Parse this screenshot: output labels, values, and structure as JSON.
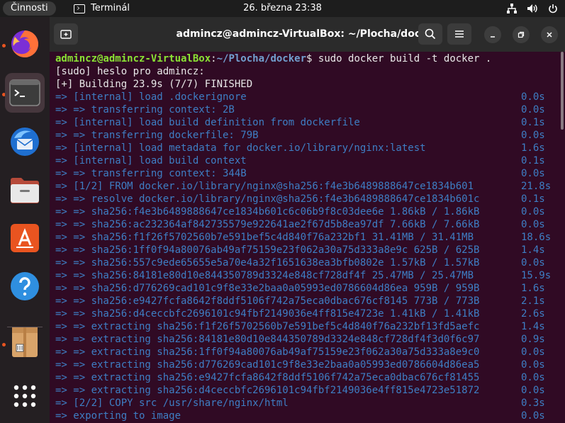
{
  "topbar": {
    "activities": "Činnosti",
    "app_name": "Terminál",
    "clock": "26. března  23:38",
    "tray_icons": [
      "network-icon",
      "volume-icon",
      "power-icon"
    ]
  },
  "dock": {
    "items": [
      {
        "name": "firefox",
        "running": true
      },
      {
        "name": "terminal",
        "running": true,
        "active": true
      },
      {
        "name": "thunderbird",
        "running": false
      },
      {
        "name": "files",
        "running": false
      },
      {
        "name": "app-center",
        "running": false
      },
      {
        "name": "help",
        "running": false
      },
      {
        "name": "archive-manager",
        "running": true
      },
      {
        "name": "show-apps",
        "running": false
      }
    ]
  },
  "window": {
    "title": "admincz@admincz-VirtualBox: ~/Plocha/docker"
  },
  "terminal": {
    "prompt_user": "admincz@admincz-VirtualBox",
    "prompt_sep": ":",
    "prompt_path": "~/Plocha/docker",
    "prompt_end": "$ ",
    "command": "sudo docker build -t docker .",
    "lines": [
      {
        "text": "[sudo] heslo pro admincz:",
        "time": "",
        "style": "plain"
      },
      {
        "text": "[+] Building 23.9s (7/7) FINISHED",
        "time": "",
        "style": "plain"
      },
      {
        "text": "=> [internal] load .dockerignore",
        "time": "0.0s",
        "style": "dim"
      },
      {
        "text": "=> => transferring context: 2B",
        "time": "0.0s",
        "style": "dim"
      },
      {
        "text": "=> [internal] load build definition from dockerfile",
        "time": "0.1s",
        "style": "dim"
      },
      {
        "text": "=> => transferring dockerfile: 79B",
        "time": "0.0s",
        "style": "dim"
      },
      {
        "text": "=> [internal] load metadata for docker.io/library/nginx:latest",
        "time": "1.6s",
        "style": "dim"
      },
      {
        "text": "=> [internal] load build context",
        "time": "0.1s",
        "style": "dim"
      },
      {
        "text": "=> => transferring context: 344B",
        "time": "0.0s",
        "style": "dim"
      },
      {
        "text": "=> [1/2] FROM docker.io/library/nginx@sha256:f4e3b6489888647ce1834b601",
        "time": "21.8s",
        "style": "dim"
      },
      {
        "text": "=> => resolve docker.io/library/nginx@sha256:f4e3b6489888647ce1834b601c",
        "time": "0.1s",
        "style": "dim"
      },
      {
        "text": "=> => sha256:f4e3b6489888647ce1834b601c6c06b9f8c03dee6e 1.86kB / 1.86kB",
        "time": "0.0s",
        "style": "dim"
      },
      {
        "text": "=> => sha256:ac232364af842735579e922641ae2f67d5b8ea97df 7.66kB / 7.66kB",
        "time": "0.0s",
        "style": "dim"
      },
      {
        "text": "=> => sha256:f1f26f5702560b7e591bef5c4d840f76a232bf1 31.41MB / 31.41MB",
        "time": "18.6s",
        "style": "dim"
      },
      {
        "text": "=> => sha256:1ff0f94a80076ab49af75159e23f062a30a75d333a8e9c 625B / 625B",
        "time": "1.4s",
        "style": "dim"
      },
      {
        "text": "=> => sha256:557c9ede65655e5a70e4a32f1651638ea3bfb0802e 1.57kB / 1.57kB",
        "time": "0.0s",
        "style": "dim"
      },
      {
        "text": "=> => sha256:84181e80d10e844350789d3324e848cf728df4f 25.47MB / 25.47MB",
        "time": "15.9s",
        "style": "dim"
      },
      {
        "text": "=> => sha256:d776269cad101c9f8e33e2baa0a05993ed0786604d86ea 959B / 959B",
        "time": "1.6s",
        "style": "dim"
      },
      {
        "text": "=> => sha256:e9427fcfa8642f8ddf5106f742a75eca0dbac676cf8145 773B / 773B",
        "time": "2.1s",
        "style": "dim"
      },
      {
        "text": "=> => sha256:d4ceccbfc2696101c94fbf2149036e4ff815e4723e 1.41kB / 1.41kB",
        "time": "2.6s",
        "style": "dim"
      },
      {
        "text": "=> => extracting sha256:f1f26f5702560b7e591bef5c4d840f76a232bf13fd5aefc",
        "time": "1.4s",
        "style": "dim"
      },
      {
        "text": "=> => extracting sha256:84181e80d10e844350789d3324e848cf728df4f3d0f6c97",
        "time": "0.9s",
        "style": "dim"
      },
      {
        "text": "=> => extracting sha256:1ff0f94a80076ab49af75159e23f062a30a75d333a8e9c0",
        "time": "0.0s",
        "style": "dim"
      },
      {
        "text": "=> => extracting sha256:d776269cad101c9f8e33e2baa0a05993ed0786604d86ea5",
        "time": "0.0s",
        "style": "dim"
      },
      {
        "text": "=> => extracting sha256:e9427fcfa8642f8ddf5106f742a75eca0dbac676cf81455",
        "time": "0.0s",
        "style": "dim"
      },
      {
        "text": "=> => extracting sha256:d4ceccbfc2696101c94fbf2149036e4ff815e4723e51872",
        "time": "0.0s",
        "style": "dim"
      },
      {
        "text": "=> [2/2] COPY src /usr/share/nginx/html",
        "time": "0.3s",
        "style": "dim"
      },
      {
        "text": "=> exporting to image",
        "time": "0.0s",
        "style": "dim"
      }
    ]
  },
  "colors": {
    "terminal_bg": "#300a24",
    "prompt_user": "#8ae234",
    "prompt_path": "#729fcf",
    "build_dim": "#3e7ec4",
    "accent": "#e95420"
  }
}
